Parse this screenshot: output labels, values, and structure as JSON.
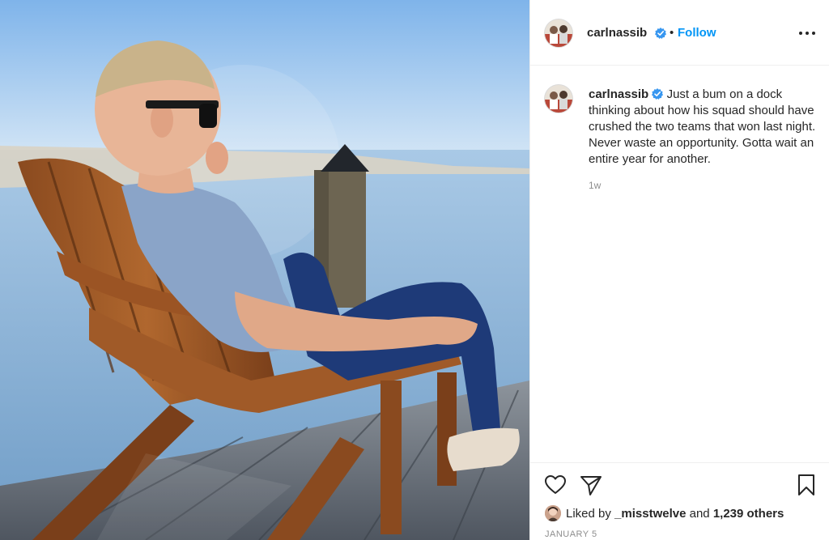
{
  "post": {
    "photo_alt": "",
    "username": "carlnassib",
    "verified": true,
    "separator": "•",
    "follow_label": "Follow",
    "more_icon": "more-options-icon",
    "caption_text": "Just a bum on a dock thinking about how his squad should have crushed the two teams that won last night. Never waste an opportunity. Gotta wait an entire year for another.",
    "relative_time": "1w",
    "liked_prefix": "Liked by",
    "liked_user": "_misstwelve",
    "liked_and": "and",
    "liked_count": "1,239 others",
    "date": "JANUARY 5",
    "colors": {
      "link": "#0095f6",
      "text": "#262626",
      "muted": "#8e8e8e",
      "verified": "#3897f0"
    },
    "icons": [
      "heart-icon",
      "share-icon",
      "bookmark-icon"
    ]
  }
}
